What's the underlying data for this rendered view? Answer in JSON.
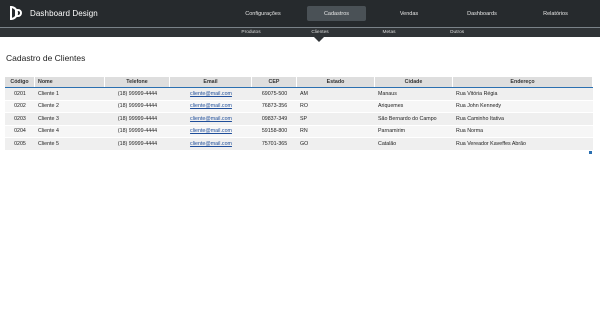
{
  "app": {
    "title": "Dashboard Design"
  },
  "nav": {
    "items": [
      {
        "label": "Configurações"
      },
      {
        "label": "Cadastros"
      },
      {
        "label": "Vendas"
      },
      {
        "label": "Dashboards"
      },
      {
        "label": "Relatórios"
      }
    ],
    "active": "Cadastros"
  },
  "subnav": {
    "items": [
      {
        "label": "Produtos"
      },
      {
        "label": "Clientes"
      },
      {
        "label": "Metas"
      },
      {
        "label": "Outros"
      }
    ],
    "active": "Clientes"
  },
  "page": {
    "title": "Cadastro de Clientes"
  },
  "table": {
    "headers": [
      "Código",
      "Nome",
      "Telefone",
      "Email",
      "CEP",
      "Estado",
      "Cidade",
      "Endereço"
    ],
    "rows": [
      [
        "0201",
        "Cliente 1",
        "(18) 99999-4444",
        "cliente@mail.com",
        "69075-500",
        "AM",
        "Manaus",
        "Rua Vitória Régia"
      ],
      [
        "0202",
        "Cliente 2",
        "(18) 99999-4444",
        "cliente@mail.com",
        "76873-356",
        "RO",
        "Ariquemes",
        "Rua John Kennedy"
      ],
      [
        "0203",
        "Cliente 3",
        "(18) 99999-4444",
        "cliente@mail.com",
        "09837-349",
        "SP",
        "São Bernardo do Campo",
        "Rua Caminho Itativa"
      ],
      [
        "0204",
        "Cliente 4",
        "(18) 99999-4444",
        "cliente@mail.com",
        "59158-800",
        "RN",
        "Parnamirim",
        "Rua Norma"
      ],
      [
        "0205",
        "Cliente 5",
        "(18) 99999-4444",
        "cliente@mail.com",
        "75701-365",
        "GO",
        "Catalão",
        "Rua Vereador Kaveffes Abrão"
      ]
    ]
  }
}
